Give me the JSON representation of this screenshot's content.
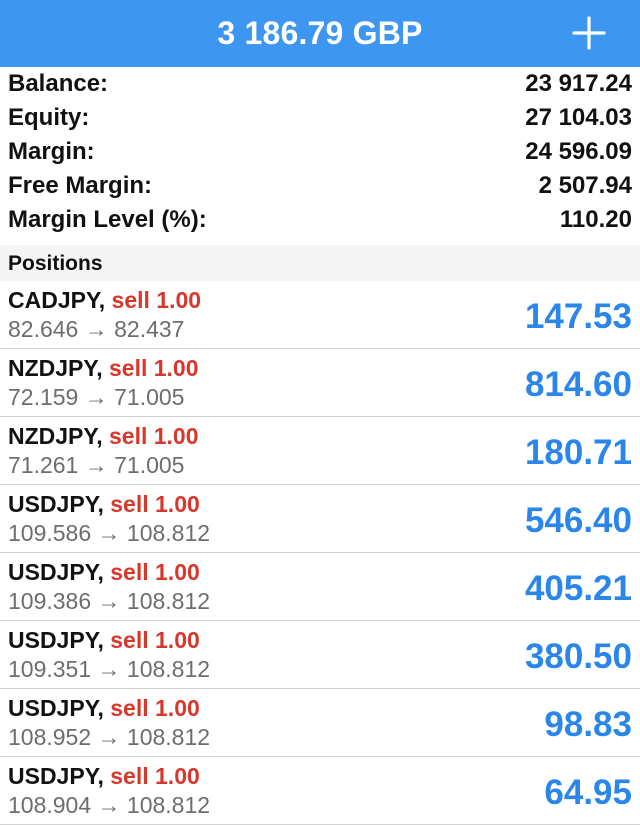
{
  "header": {
    "title": "3 186.79 GBP",
    "add_icon": "plus-icon"
  },
  "summary": [
    {
      "label": "Balance:",
      "value": "23 917.24"
    },
    {
      "label": "Equity:",
      "value": "27 104.03"
    },
    {
      "label": "Margin:",
      "value": "24 596.09"
    },
    {
      "label": "Free Margin:",
      "value": "2 507.94"
    },
    {
      "label": "Margin Level (%):",
      "value": "110.20"
    }
  ],
  "positions_header": "Positions",
  "positions": [
    {
      "symbol": "CADJPY",
      "side": "sell 1.00",
      "prices": "82.646 → 82.437",
      "profit": "147.53"
    },
    {
      "symbol": "NZDJPY",
      "side": "sell 1.00",
      "prices": "72.159 → 71.005",
      "profit": "814.60"
    },
    {
      "symbol": "NZDJPY",
      "side": "sell 1.00",
      "prices": "71.261 → 71.005",
      "profit": "180.71"
    },
    {
      "symbol": "USDJPY",
      "side": "sell 1.00",
      "prices": "109.586 → 108.812",
      "profit": "546.40"
    },
    {
      "symbol": "USDJPY",
      "side": "sell 1.00",
      "prices": "109.386 → 108.812",
      "profit": "405.21"
    },
    {
      "symbol": "USDJPY",
      "side": "sell 1.00",
      "prices": "109.351 → 108.812",
      "profit": "380.50"
    },
    {
      "symbol": "USDJPY",
      "side": "sell 1.00",
      "prices": "108.952 → 108.812",
      "profit": "98.83"
    },
    {
      "symbol": "USDJPY",
      "side": "sell 1.00",
      "prices": "108.904 → 108.812",
      "profit": "64.95"
    }
  ],
  "colors": {
    "header_bg": "#3d96f0",
    "profit": "#2a86e8",
    "sell": "#d8372b",
    "price_text": "#6d6d6d",
    "section_bg": "#f5f5f5"
  }
}
